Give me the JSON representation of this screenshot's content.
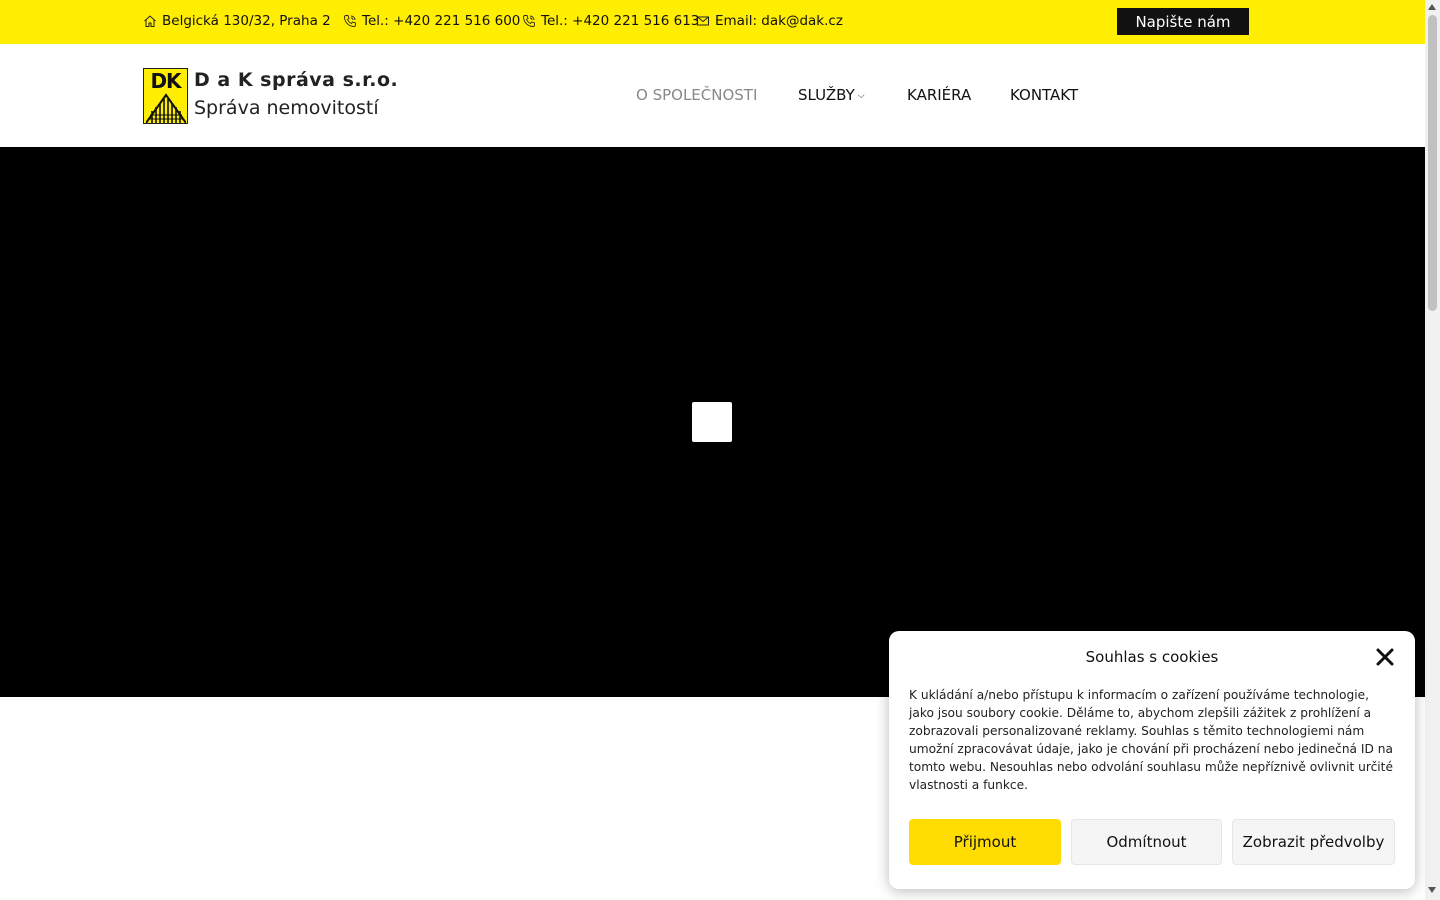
{
  "topbar": {
    "address": "Belgická 130/32, Praha 2",
    "phone1": "Tel.: +420 221 516 600",
    "phone2": "Tel.: +420 221 516 613",
    "email": "Email: dak@dak.cz",
    "cta_label": "Napište nám",
    "background_color": "#ffee00"
  },
  "brand": {
    "logo_text": "DK",
    "name": "D a K správa s.r.o.",
    "tagline": "Správa nemovitostí"
  },
  "nav": {
    "items": [
      {
        "label": "O SPOLEČNOSTI",
        "active": true
      },
      {
        "label": "SLUŽBY",
        "has_dropdown": true
      },
      {
        "label": "KARIÉRA"
      },
      {
        "label": "KONTAKT"
      }
    ]
  },
  "hero": {
    "background_color": "#000000"
  },
  "cookie": {
    "title": "Souhlas s cookies",
    "text": "K ukládání a/nebo přístupu k informacím o zařízení používáme technologie, jako jsou soubory cookie. Děláme to, abychom zlepšili zážitek z prohlížení a zobrazovali personalizované reklamy. Souhlas s těmito technologiemi nám umožní zpracovávat údaje, jako je chování při procházení nebo jedinečná ID na tomto webu. Nesouhlas nebo odvolání souhlasu může nepříznivě ovlivnit určité vlastnosti a funkce.",
    "accept_label": "Přijmout",
    "deny_label": "Odmítnout",
    "prefs_label": "Zobrazit předvolby",
    "accept_color": "#ffdd00"
  },
  "icons": {
    "address": "home-icon",
    "phone": "phone-icon",
    "email": "envelope-icon",
    "close": "close-icon",
    "play": "play-icon"
  }
}
